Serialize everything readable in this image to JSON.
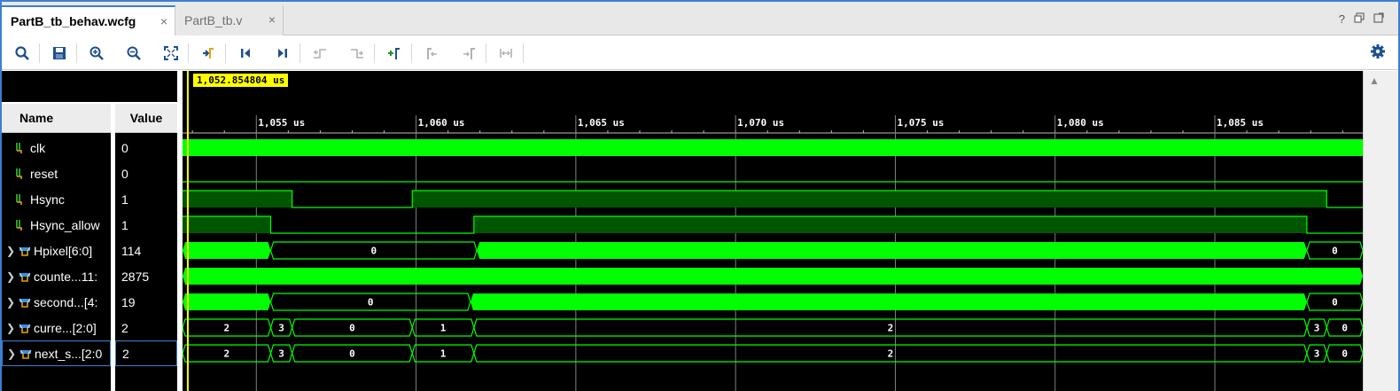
{
  "tabs": [
    {
      "label": "PartB_tb_behav.wcfg",
      "active": true,
      "close": "×"
    },
    {
      "label": "PartB_tb.v",
      "active": false,
      "close": "×"
    }
  ],
  "window_controls": [
    "?",
    "restore-icon",
    "maximize-icon"
  ],
  "toolbar": {
    "buttons": [
      {
        "icon": "search-icon",
        "enabled": true
      },
      {
        "icon": "save-icon",
        "enabled": true
      },
      {
        "icon": "zoom-in-icon",
        "enabled": true
      },
      {
        "icon": "zoom-out-icon",
        "enabled": true
      },
      {
        "icon": "zoom-fit-icon",
        "enabled": true
      },
      {
        "icon": "go-to-cursor-icon",
        "enabled": true
      },
      {
        "icon": "go-to-time-zero-icon",
        "enabled": true
      },
      {
        "icon": "go-to-last-time-icon",
        "enabled": true
      },
      {
        "icon": "previous-transition-icon",
        "enabled": false
      },
      {
        "icon": "next-transition-icon",
        "enabled": false
      },
      {
        "icon": "add-marker-icon",
        "enabled": true
      },
      {
        "icon": "previous-marker-icon",
        "enabled": false
      },
      {
        "icon": "next-marker-icon",
        "enabled": false
      },
      {
        "icon": "swap-cursors-icon",
        "enabled": false
      }
    ],
    "settings_icon": "gear-icon"
  },
  "columns": {
    "name": "Name",
    "value": "Value"
  },
  "cursor": {
    "label": "1,052.854804 us",
    "time_us": 1052.854804
  },
  "timeline": {
    "start_us": 1052.69,
    "end_us": 1089.63,
    "ticks": [
      {
        "t": 1055,
        "label": "1,055 us"
      },
      {
        "t": 1060,
        "label": "1,060 us"
      },
      {
        "t": 1065,
        "label": "1,065 us"
      },
      {
        "t": 1070,
        "label": "1,070 us"
      },
      {
        "t": 1075,
        "label": "1,075 us"
      },
      {
        "t": 1080,
        "label": "1,080 us"
      },
      {
        "t": 1085,
        "label": "1,085 us"
      }
    ]
  },
  "colors": {
    "wave_green": "#00ff00",
    "wave_dark": "#005500",
    "cursor": "#ffff00",
    "grid": "#808080",
    "accent": "#3b7fd2"
  },
  "signals": [
    {
      "name": "clk",
      "value": "0",
      "kind": "bit",
      "expandable": false,
      "wave": {
        "type": "dense"
      }
    },
    {
      "name": "reset",
      "value": "0",
      "kind": "bit",
      "expandable": false,
      "wave": {
        "type": "low"
      }
    },
    {
      "name": "Hsync",
      "value": "1",
      "kind": "bit",
      "expandable": false,
      "wave": {
        "type": "bit",
        "segments": [
          {
            "from": 1052.69,
            "to": 1056.12,
            "level": 1
          },
          {
            "from": 1056.12,
            "to": 1059.88,
            "level": 0
          },
          {
            "from": 1059.88,
            "to": 1088.5,
            "level": 1
          },
          {
            "from": 1088.5,
            "to": 1089.63,
            "level": 0
          }
        ]
      }
    },
    {
      "name": "Hsync_allow",
      "value": "1",
      "kind": "bit",
      "expandable": false,
      "wave": {
        "type": "bit",
        "segments": [
          {
            "from": 1052.69,
            "to": 1055.45,
            "level": 1
          },
          {
            "from": 1055.45,
            "to": 1061.81,
            "level": 0
          },
          {
            "from": 1061.81,
            "to": 1087.88,
            "level": 1
          },
          {
            "from": 1087.88,
            "to": 1089.63,
            "level": 0
          }
        ]
      }
    },
    {
      "name": "Hpixel[6:0]",
      "value": "114",
      "kind": "bus",
      "expandable": true,
      "wave": {
        "type": "bus",
        "segments": [
          {
            "from": 1052.69,
            "to": 1055.45,
            "dense": true,
            "label": ""
          },
          {
            "from": 1055.45,
            "to": 1061.9,
            "dense": false,
            "label": "0"
          },
          {
            "from": 1061.9,
            "to": 1087.88,
            "dense": true,
            "label": ""
          },
          {
            "from": 1087.88,
            "to": 1089.63,
            "dense": false,
            "label": "0"
          }
        ]
      }
    },
    {
      "name": "counte...11:",
      "value": "2875",
      "kind": "bus",
      "expandable": true,
      "wave": {
        "type": "bus",
        "segments": [
          {
            "from": 1052.69,
            "to": 1089.63,
            "dense": true,
            "label": ""
          }
        ]
      }
    },
    {
      "name": "second...[4:",
      "value": "19",
      "kind": "bus",
      "expandable": true,
      "wave": {
        "type": "bus",
        "segments": [
          {
            "from": 1052.69,
            "to": 1055.45,
            "dense": true,
            "label": ""
          },
          {
            "from": 1055.45,
            "to": 1061.7,
            "dense": false,
            "label": "0"
          },
          {
            "from": 1061.7,
            "to": 1087.88,
            "dense": true,
            "label": ""
          },
          {
            "from": 1087.88,
            "to": 1089.63,
            "dense": false,
            "label": "0"
          }
        ]
      }
    },
    {
      "name": "curre...[2:0]",
      "value": "2",
      "kind": "bus",
      "expandable": true,
      "wave": {
        "type": "bus",
        "segments": [
          {
            "from": 1052.69,
            "to": 1055.45,
            "dense": false,
            "label": "2"
          },
          {
            "from": 1055.45,
            "to": 1056.12,
            "dense": false,
            "label": "3"
          },
          {
            "from": 1056.12,
            "to": 1059.88,
            "dense": false,
            "label": "0"
          },
          {
            "from": 1059.88,
            "to": 1061.81,
            "dense": false,
            "label": "1"
          },
          {
            "from": 1061.81,
            "to": 1087.88,
            "dense": false,
            "label": "2"
          },
          {
            "from": 1087.88,
            "to": 1088.5,
            "dense": false,
            "label": "3"
          },
          {
            "from": 1088.5,
            "to": 1089.63,
            "dense": false,
            "label": "0"
          }
        ]
      }
    },
    {
      "name": "next_s...[2:0",
      "value": "2",
      "kind": "bus",
      "expandable": true,
      "selected": true,
      "wave": {
        "type": "bus",
        "segments": [
          {
            "from": 1052.69,
            "to": 1055.45,
            "dense": false,
            "label": "2"
          },
          {
            "from": 1055.45,
            "to": 1056.12,
            "dense": false,
            "label": "3"
          },
          {
            "from": 1056.12,
            "to": 1059.88,
            "dense": false,
            "label": "0"
          },
          {
            "from": 1059.88,
            "to": 1061.81,
            "dense": false,
            "label": "1"
          },
          {
            "from": 1061.81,
            "to": 1087.88,
            "dense": false,
            "label": "2"
          },
          {
            "from": 1087.88,
            "to": 1088.5,
            "dense": false,
            "label": "3"
          },
          {
            "from": 1088.5,
            "to": 1089.63,
            "dense": false,
            "label": "0"
          }
        ]
      }
    }
  ]
}
